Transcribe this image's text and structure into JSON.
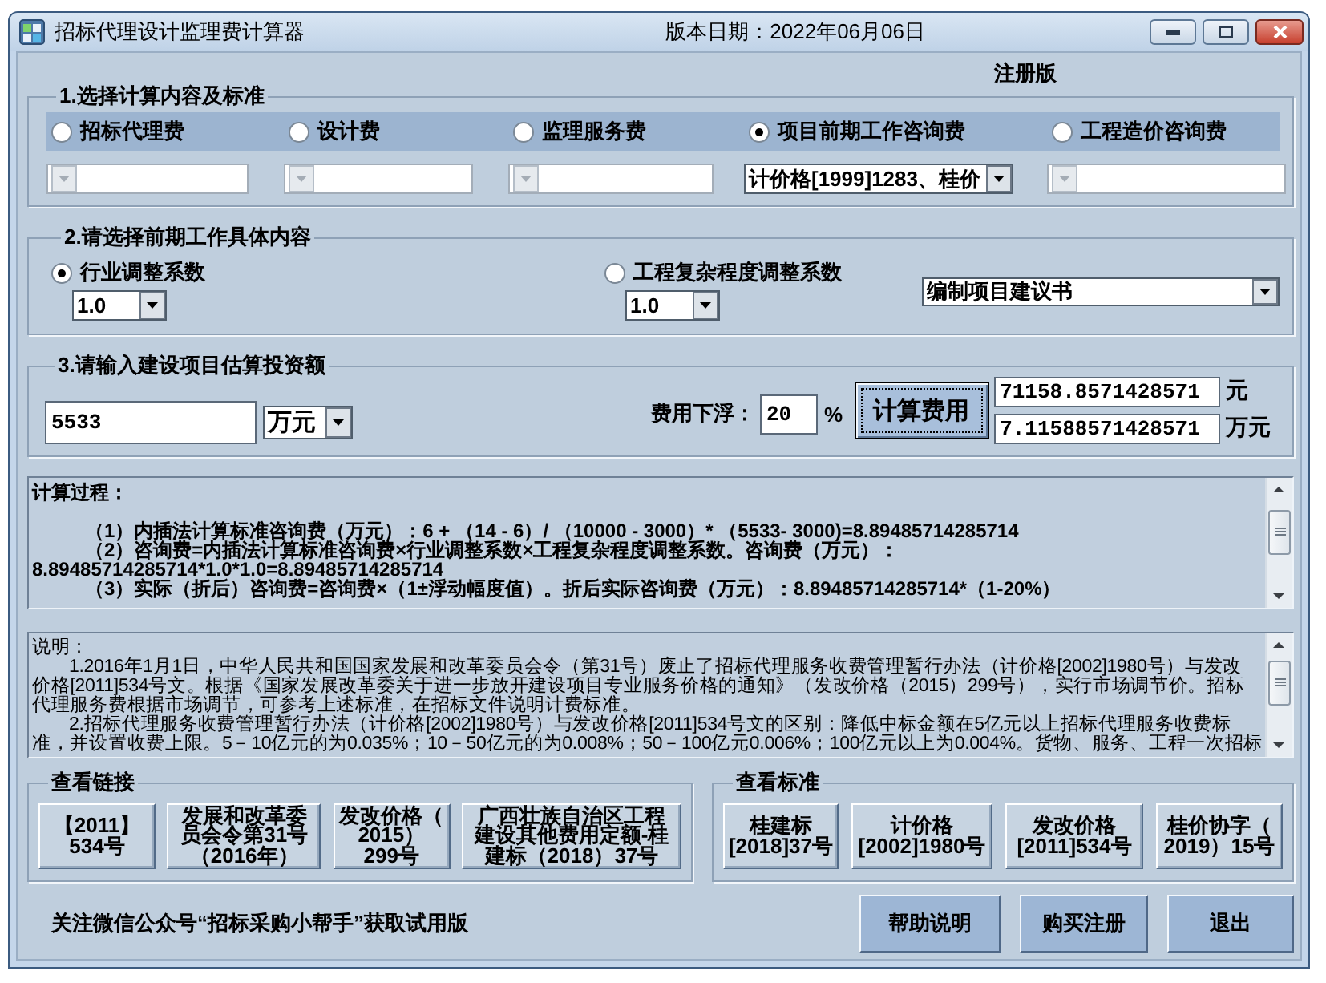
{
  "window": {
    "title": "招标代理设计监理费计算器",
    "version_date": "版本日期：2022年06月06日"
  },
  "edition": "注册版",
  "fee_types": {
    "legend": "1.选择计算内容及标准",
    "options": [
      {
        "label": "招标代理费",
        "selected": false
      },
      {
        "label": "设计费",
        "selected": false
      },
      {
        "label": "监理服务费",
        "selected": false
      },
      {
        "label": "项目前期工作咨询费",
        "selected": true,
        "standard": "计价格[1999]1283、桂价"
      },
      {
        "label": "工程造价咨询费",
        "selected": false
      }
    ]
  },
  "work_content": {
    "legend": "2.请选择前期工作具体内容",
    "factors": [
      {
        "label": "行业调整系数",
        "selected": true,
        "value": "1.0"
      },
      {
        "label": "工程复杂程度调整系数",
        "selected": false,
        "value": "1.0"
      }
    ],
    "work_item": "编制项目建议书"
  },
  "investment": {
    "legend": "3.请输入建设项目估算投资额",
    "amount": "5533",
    "unit": "万元",
    "discount_label": "费用下浮：",
    "discount": "20",
    "percent_sign": "%",
    "calculate_button": "计算费用",
    "results": [
      {
        "value": "71158.8571428571",
        "unit": "元"
      },
      {
        "value": "7.11588571428571",
        "unit": "万元"
      }
    ]
  },
  "calculation": {
    "title": "计算过程：",
    "lines": [
      {
        "kind": "start",
        "text": "（1）内插法计算标准咨询费（万元）：6 + （14 - 6）/ （10000 - 3000）* （5533- 3000)=8.89485714285714"
      },
      {
        "kind": "start",
        "text": "（2）咨询费=内插法计算标准咨询费×行业调整系数×工程复杂程度调整系数。咨询费（万元）："
      },
      {
        "kind": "wrap",
        "text": "8.89485714285714*1.0*1.0=8.89485714285714"
      },
      {
        "kind": "start",
        "text": "（3）实际（折后）咨询费=咨询费×（1±浮动幅度值）。折后实际咨询费（万元）：8.89485714285714*（1-20%）"
      }
    ]
  },
  "explanation": {
    "title": "说明：",
    "lines": [
      {
        "kind": "start",
        "text": "1.2016年1月1日，中华人民共和国国家发展和改革委员会令（第31号）废止了招标代理服务收费管理暂行办法（计价格[2002]1980号）与发改"
      },
      {
        "kind": "wrap",
        "text": "价格[2011]534号文。根据《国家发展改革委关于进一步放开建设项目专业服务价格的通知》（发改价格（2015）299号），实行市场调节价。招标"
      },
      {
        "kind": "wrap",
        "text": "代理服务费根据市场调节，可参考上述标准，在招标文件说明计费标准。"
      },
      {
        "kind": "start",
        "text": "2.招标代理服务收费管理暂行办法（计价格[2002]1980号）与发改价格[2011]534号文的区别：降低中标金额在5亿元以上招标代理服务收费标"
      },
      {
        "kind": "wrap",
        "text": "准，并设置收费上限。5－10亿元的为0.035%；10－50亿元的为0.008%；50－100亿元0.006%；100亿元以上为0.004%。货物、服务、工程一次招标"
      }
    ]
  },
  "links": {
    "legend": "查看链接",
    "buttons": [
      "【2011】\n534号",
      "发展和改革委员会令第31号（2016年）",
      "发改价格（\n2015）\n299号",
      "广西壮族自治区工程建设其他费用定额-桂建标（2018）37号"
    ]
  },
  "standards": {
    "legend": "查看标准",
    "buttons": [
      "桂建标\n[2018]37号",
      "计价格\n[2002]1980号",
      "发改价格\n[2011]534号",
      "桂价协字（\n2019）15号"
    ]
  },
  "footer": {
    "notice": "关注微信公众号“招标采购小帮手”获取试用版",
    "buttons": [
      "帮助说明",
      "购买注册",
      "退出"
    ]
  }
}
